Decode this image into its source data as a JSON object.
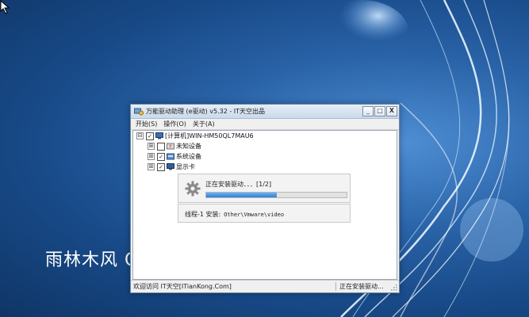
{
  "desktop": {
    "brand_text": "雨林木风",
    "brand_partial": "C"
  },
  "window": {
    "title": "万能驱动助理 (e驱动) v5.32 - IT天空出品",
    "controls": {
      "minimize": "_",
      "maximize": "□",
      "close": "X"
    },
    "menu": [
      "开始(S)",
      "操作(O)",
      "关于(A)"
    ],
    "tree": {
      "root": {
        "expander": "⊟",
        "checked": true,
        "label": "[计算机]WIN-HM50QL7MAU6"
      },
      "children": [
        {
          "expander": "⊞",
          "checked": false,
          "label": "未知设备"
        },
        {
          "expander": "⊞",
          "checked": true,
          "label": "系统设备"
        },
        {
          "expander": "⊞",
          "checked": true,
          "label": "显示卡"
        }
      ]
    },
    "progress": {
      "text": "正在安装驱动．．．[1/2]",
      "value_percent": 50
    },
    "thread": {
      "label": "线程-1 安装:",
      "path": "Other\\Vmware\\video"
    },
    "status": {
      "left": "欢迎访问 IT天空[ITianKong.Com]",
      "right": "正在安装驱动..."
    }
  },
  "icons": {
    "cursor": "arrow-cursor-icon",
    "app": "app-icon",
    "gear": "gear-icon",
    "computer": "computer-icon",
    "device": "device-icon"
  }
}
